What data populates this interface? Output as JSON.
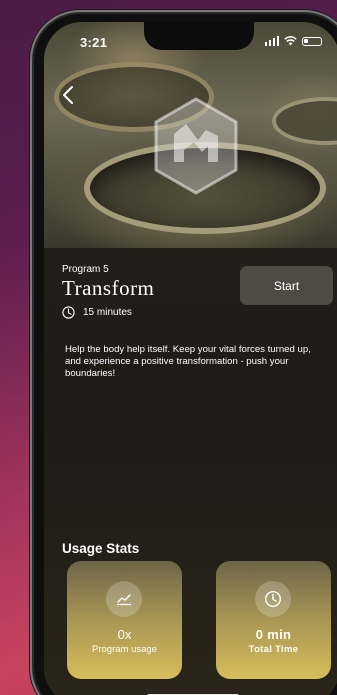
{
  "status_bar": {
    "time": "3:21"
  },
  "program": {
    "number": "Program 5",
    "title": "Transform",
    "duration": "15 minutes",
    "start_label": "Start",
    "description": "Help the body help itself. Keep your vital forces turned up, and experience a positive transformation - push your boundaries!"
  },
  "usage_stats": {
    "heading": "Usage Stats",
    "cards": [
      {
        "value": "0x",
        "label": "Program usage",
        "icon": "trend-chart-icon"
      },
      {
        "value": "0 min",
        "label": "Total Time",
        "icon": "clock-icon"
      }
    ]
  },
  "colors": {
    "card_gradient_top": "#6d6548",
    "card_gradient_bottom": "#d7bd5a",
    "start_button_bg": "#4e4b42",
    "background_accent": "#c8435e"
  }
}
